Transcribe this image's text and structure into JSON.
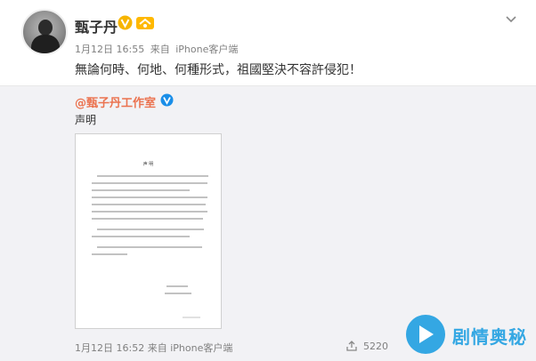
{
  "post": {
    "author": "甄子丹",
    "time": "1月12日 16:55",
    "source_prefix": "来自",
    "source": "iPhone客户端",
    "text": "無論何時、何地、何種形式，祖國堅決不容許侵犯！"
  },
  "repost": {
    "author": "@甄子丹工作室",
    "text": "声明",
    "time": "1月12日 16:52",
    "source_prefix": "来自",
    "source": "iPhone客户端",
    "share_count": "5220"
  },
  "document": {
    "title": "声  明"
  },
  "watermark": {
    "logo_text": "剧情奥秘"
  },
  "colors": {
    "link": "#eb7350",
    "verified_gold": "#f7b500",
    "watermark_blue": "#34a7e3"
  },
  "icons": [
    "chevron-down-icon",
    "verified-icon",
    "level-badge-icon",
    "share-icon",
    "play-icon"
  ]
}
